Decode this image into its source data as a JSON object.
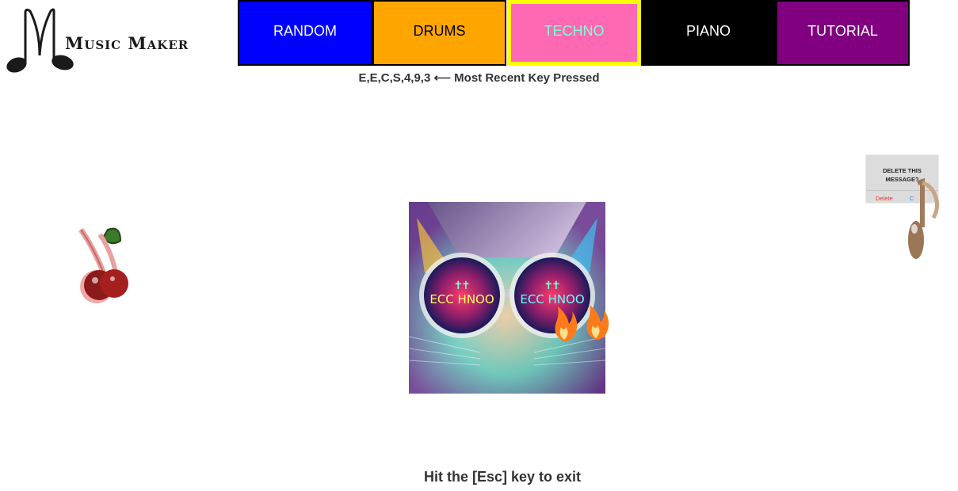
{
  "logo": {
    "text": "Music Maker"
  },
  "nav": [
    {
      "label": "RANDOM",
      "bg": "#0000ff",
      "fg": "#ffffff",
      "border": "#000000",
      "active": false
    },
    {
      "label": "DRUMS",
      "bg": "#ffa500",
      "fg": "#000000",
      "border": "#000000",
      "active": false
    },
    {
      "label": "TECHNO",
      "bg": "#ff69b4",
      "fg": "#7fffd4",
      "border": "#ffff00",
      "active": true
    },
    {
      "label": "PIANO",
      "bg": "#000000",
      "fg": "#ffffff",
      "border": "#000000",
      "active": false
    },
    {
      "label": "TUTORIAL",
      "bg": "#800080",
      "fg": "#ffffff",
      "border": "#000000",
      "active": false
    }
  ],
  "recent_keys": "E,E,C,S,4,9,3 ⟵ Most Recent Key Pressed",
  "center_image": {
    "icon": "techno-cat-image",
    "lens_text": "ECC HNOO"
  },
  "left_sprite": {
    "icon": "cherry-icon"
  },
  "right_sprite": {
    "dialog_title": "DELETE THIS MESSAGE?",
    "delete_label": "Delete",
    "cancel_label": "C"
  },
  "footer": {
    "exit_text": "Hit the [Esc] key to exit"
  }
}
